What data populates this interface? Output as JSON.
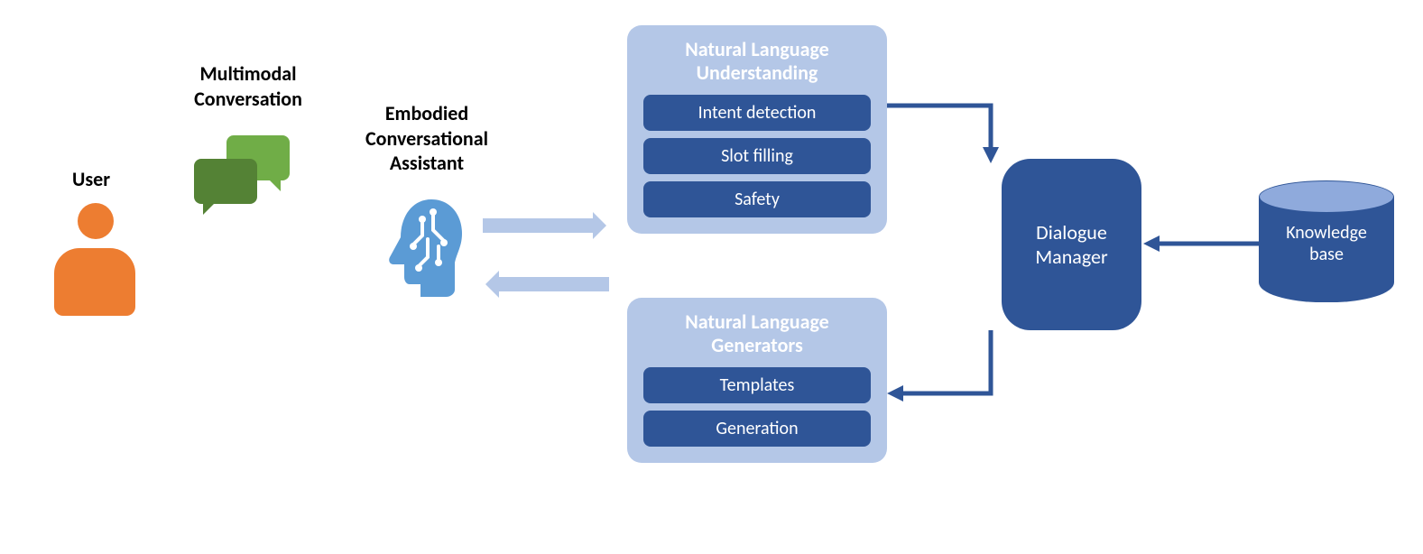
{
  "user": {
    "label": "User"
  },
  "conversation": {
    "label": "Multimodal\nConversation"
  },
  "assistant": {
    "label": "Embodied\nConversational\nAssistant"
  },
  "nlu": {
    "title": "Natural Language\nUnderstanding",
    "items": [
      "Intent detection",
      "Slot filling",
      "Safety"
    ]
  },
  "nlg": {
    "title": "Natural Language\nGenerators",
    "items": [
      "Templates",
      "Generation"
    ]
  },
  "dm": {
    "label": "Dialogue\nManager"
  },
  "kb": {
    "label": "Knowledge\nbase"
  },
  "colors": {
    "orange": "#ED7D31",
    "green_light": "#70AD47",
    "green_dark": "#548235",
    "blue_light": "#B4C7E7",
    "blue_mid": "#8FAADC",
    "blue_dark": "#2F5597",
    "ai_blue": "#5B9BD5"
  }
}
